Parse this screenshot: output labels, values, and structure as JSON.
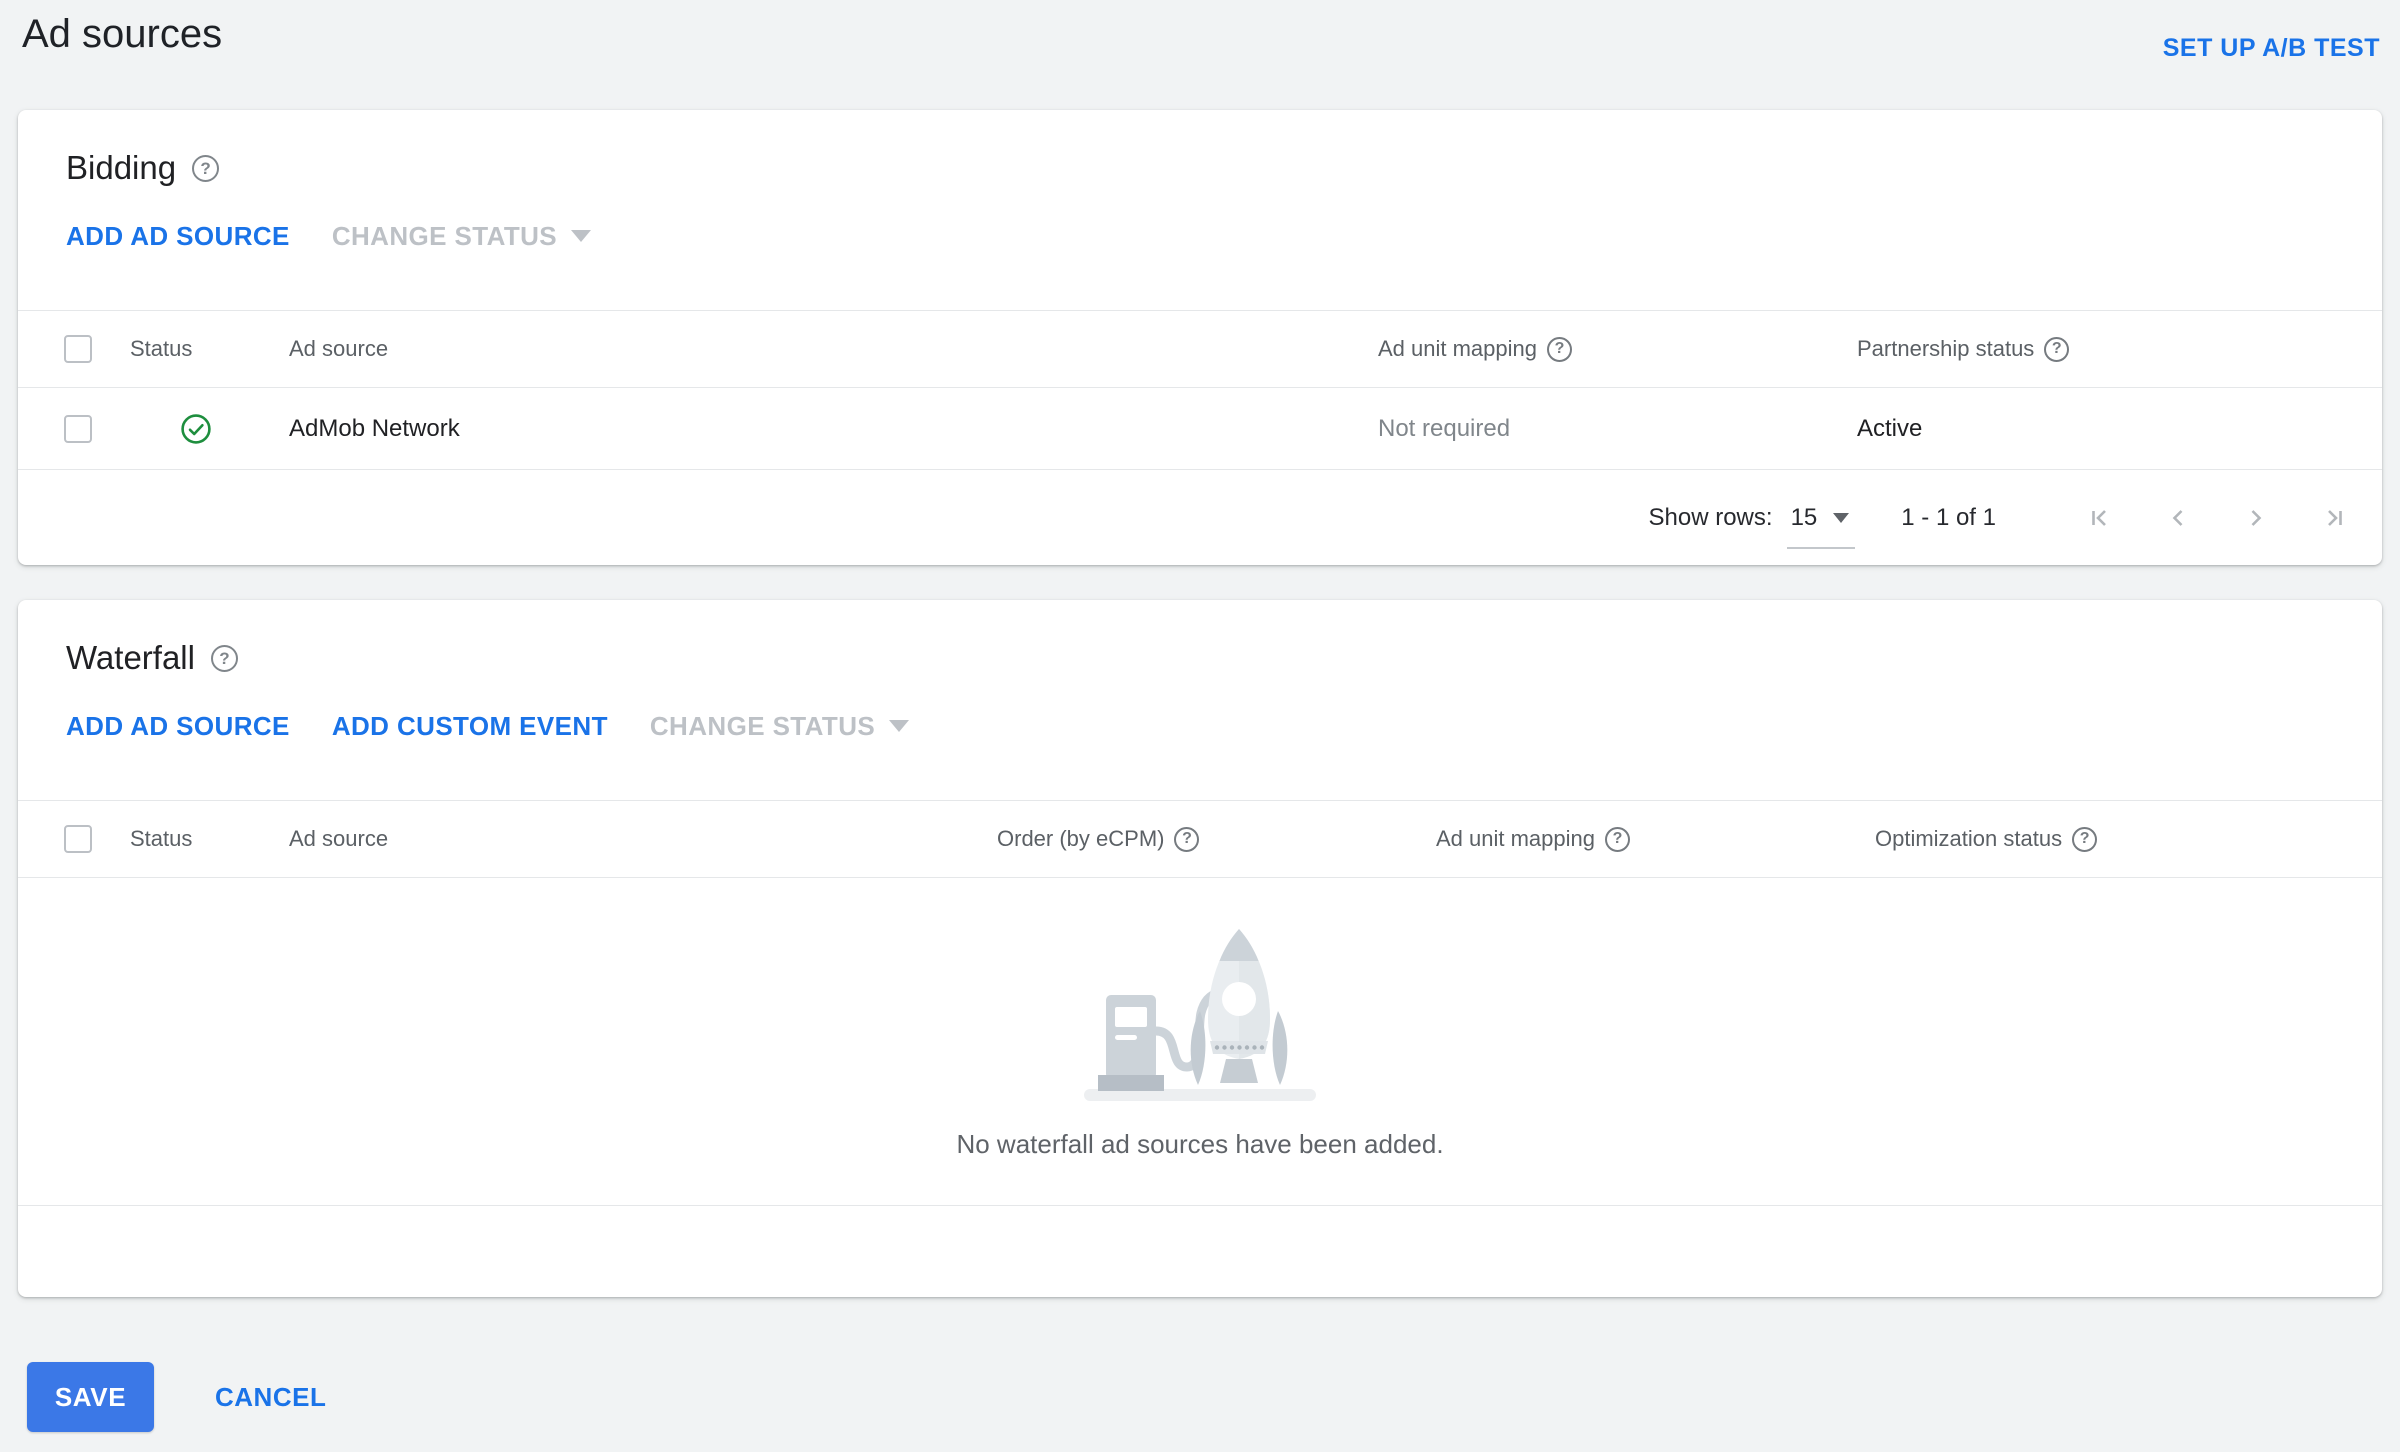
{
  "page": {
    "title": "Ad sources",
    "ab_test_link": "SET UP A/B TEST"
  },
  "icons": {
    "help_glyph": "?"
  },
  "bidding": {
    "title": "Bidding",
    "actions": {
      "add_ad_source": "ADD AD SOURCE",
      "change_status": "CHANGE STATUS"
    },
    "columns": {
      "status": "Status",
      "ad_source": "Ad source",
      "ad_unit_mapping": "Ad unit mapping",
      "partnership_status": "Partnership status"
    },
    "row": {
      "status": "active",
      "ad_source": "AdMob Network",
      "ad_unit_mapping": "Not required",
      "partnership_status": "Active"
    },
    "pagination": {
      "show_rows_label": "Show rows:",
      "rows_per_page": "15",
      "range": "1 - 1 of 1"
    }
  },
  "waterfall": {
    "title": "Waterfall",
    "actions": {
      "add_ad_source": "ADD AD SOURCE",
      "add_custom_event": "ADD CUSTOM EVENT",
      "change_status": "CHANGE STATUS"
    },
    "columns": {
      "status": "Status",
      "ad_source": "Ad source",
      "order": "Order (by eCPM)",
      "ad_unit_mapping": "Ad unit mapping",
      "optimization_status": "Optimization status"
    },
    "empty_message": "No waterfall ad sources have been added."
  },
  "footer": {
    "save": "SAVE",
    "cancel": "CANCEL"
  },
  "colors": {
    "link_blue": "#1a73e8",
    "button_blue": "#3b78e7",
    "success_green": "#1e8e3e",
    "page_background": "#f1f3f4"
  }
}
